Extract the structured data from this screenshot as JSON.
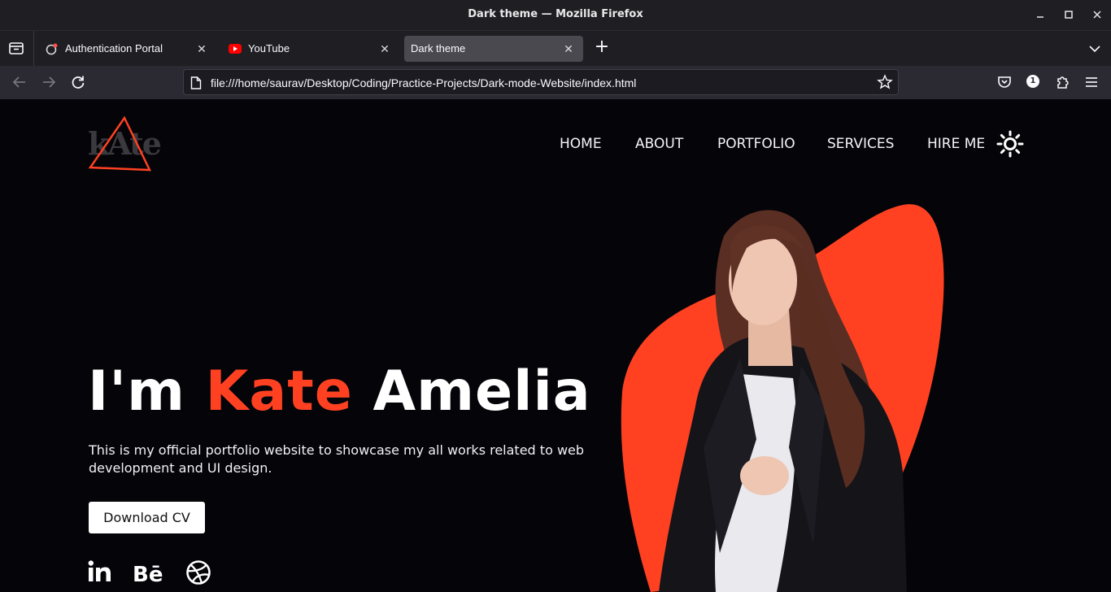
{
  "window": {
    "title": "Dark theme — Mozilla Firefox",
    "minimize_icon": "minimize-icon",
    "maximize_icon": "maximize-icon",
    "close_icon": "close-icon"
  },
  "tabs": [
    {
      "label": "Authentication Portal",
      "favicon": "portal-icon",
      "active": false
    },
    {
      "label": "YouTube",
      "favicon": "youtube-icon",
      "active": false
    },
    {
      "label": "Dark theme",
      "favicon": "",
      "active": true
    }
  ],
  "toolbar": {
    "url": "file:///home/saurav/Desktop/Coding/Practice-Projects/Dark-mode-Website/index.html",
    "extensions_badge": "1"
  },
  "site": {
    "logo_text": "kAte",
    "menu": [
      "HOME",
      "ABOUT",
      "PORTFOLIO",
      "SERVICES",
      "HIRE ME"
    ],
    "hero": {
      "prefix": "I'm ",
      "first_name": "Kate",
      "last_name": " Amelia",
      "description": "This is my official portfolio website to showcase my all works related to web development and UI design.",
      "cta": "Download CV"
    },
    "social": [
      "linkedin-icon",
      "behance-icon",
      "dribbble-icon"
    ],
    "colors": {
      "accent": "#ff4122",
      "background": "#040409"
    }
  }
}
